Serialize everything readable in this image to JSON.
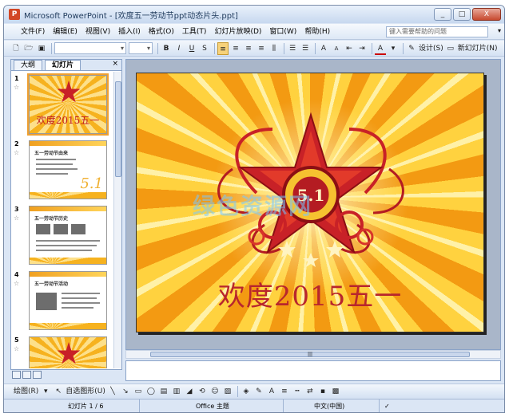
{
  "window": {
    "app_icon": "P",
    "title": "Microsoft PowerPoint - [欢度五一劳动节ppt动态片头.ppt]",
    "controls": [
      "_",
      "□",
      "X"
    ]
  },
  "menubar": {
    "items": [
      "文件(F)",
      "编辑(E)",
      "视图(V)",
      "插入(I)",
      "格式(O)",
      "工具(T)",
      "幻灯片放映(D)",
      "窗口(W)",
      "帮助(H)"
    ],
    "help_placeholder": "键入需要帮助的问题"
  },
  "toolbar": {
    "bold": "B",
    "italic": "I",
    "underline": "U",
    "shadow": "S",
    "grow_font": "A",
    "shrink_font": "A",
    "font_color": "A",
    "design_label": "设计(S)",
    "new_slide_label": "新幻灯片(N)"
  },
  "left_panel": {
    "tabs": [
      "大纲",
      "幻灯片"
    ],
    "close": "×",
    "slides": [
      {
        "number": "1",
        "title": "欢度2015五一"
      },
      {
        "number": "2",
        "heading": "五一劳动节由来",
        "big": "5.1"
      },
      {
        "number": "3",
        "heading": "五一劳动节历史"
      },
      {
        "number": "4",
        "heading": "五一劳动节活动"
      },
      {
        "number": "5",
        "title": ""
      }
    ]
  },
  "slide": {
    "title": "欢度2015五一",
    "badge": "5.1",
    "watermark": "绿色资源网"
  },
  "hscroll": {
    "grip": "|||"
  },
  "drawbar": {
    "draw_label": "绘图(R)",
    "autoshapes_label": "自选图形(U)"
  },
  "statusbar": {
    "slide_count": "幻灯片 1 / 6",
    "theme": "Office 主题",
    "language": "中文(中国)"
  },
  "colors": {
    "ray_dark": "#f39a12",
    "ray_light": "#ffd23f",
    "star_red": "#c82127",
    "title_red": "#b8262d",
    "ui_blue": "#dbe6f5"
  }
}
